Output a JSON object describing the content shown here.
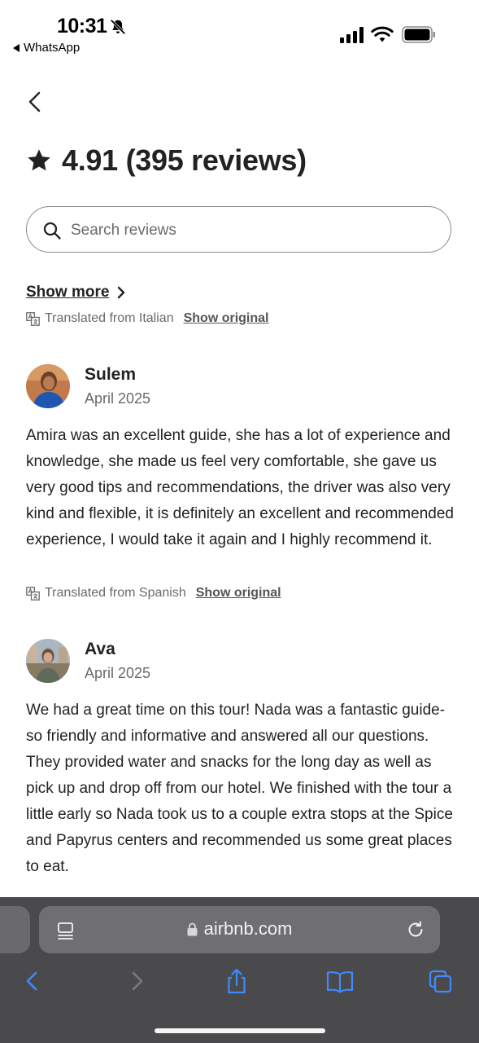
{
  "status_bar": {
    "time": "10:31",
    "back_app_label": "WhatsApp",
    "icons": [
      "bell-slash-icon",
      "cellular-signal-icon",
      "wifi-icon",
      "battery-icon"
    ]
  },
  "header": {
    "rating": "4.91 (395 reviews)"
  },
  "search": {
    "placeholder": "Search reviews"
  },
  "show_more": {
    "label": "Show more"
  },
  "translation_notice": {
    "text": "Translated from Italian",
    "show_original": "Show original"
  },
  "reviews": [
    {
      "name": "Sulem",
      "date": "April 2025",
      "text": "Amira was an excellent guide, she has a lot of experience and knowledge, she made us feel very comfortable, she gave us very good tips and recommendations, the driver was also very kind and flexible, it is definitely an excellent and recommended experience, I would take it again and I highly recommend it.",
      "translation": "Translated from Spanish",
      "show_original": "Show original"
    },
    {
      "name": "Ava",
      "date": "April 2025",
      "text": "We had a great time on this tour! Nada was a fantastic guide- so friendly and informative and answered all our questions. They provided water and snacks for the long day as well as pick up and drop off from our hotel. We finished with the tour a little early so Nada took us to a couple extra stops at the Spice and Papyrus centers and recommended us some great places to eat."
    }
  ],
  "browser": {
    "url": "airbnb.com"
  },
  "colors": {
    "text": "#222222",
    "muted": "#6a6a6a",
    "chrome_bg": "#4a4a4c",
    "toolbar_active": "#3d8bff",
    "toolbar_disabled": "#7a7a7e"
  }
}
